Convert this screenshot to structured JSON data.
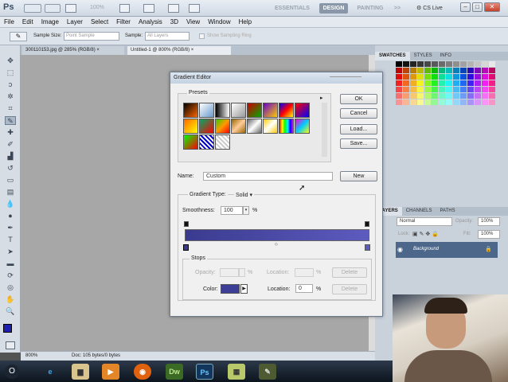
{
  "app": {
    "logo": "Ps",
    "zoom": "100%"
  },
  "workspace": {
    "essentials": "ESSENTIALS",
    "design": "DESIGN",
    "painting": "PAINTING",
    "more": ">>",
    "cs_live": "CS Live"
  },
  "menu": [
    "File",
    "Edit",
    "Image",
    "Layer",
    "Select",
    "Filter",
    "Analysis",
    "3D",
    "View",
    "Window",
    "Help"
  ],
  "options": {
    "sample_size_label": "Sample Size:",
    "sample_size_value": "Point Sample",
    "sample_label": "Sample:",
    "sample_value": "All Layers",
    "show_ring": "Show Sampling Ring"
  },
  "tabs": [
    {
      "label": "300110153.jpg @ 285% (RGB/8) ×"
    },
    {
      "label": "Untitled-1 @ 800% (RGB/8) ×"
    }
  ],
  "status": {
    "zoom": "800%",
    "doc": "Doc: 105 bytes/0 bytes"
  },
  "panels": {
    "tabs_top": [
      "SWATCHES",
      "STYLES",
      "INFO"
    ],
    "tabs_layers": [
      "LAYERS",
      "CHANNELS",
      "PATHS"
    ],
    "blend": "Normal",
    "opacity_label": "Opacity:",
    "opacity": "100%",
    "lock_label": "Lock:",
    "fill_label": "Fill:",
    "fill": "100%",
    "layer_name": "Background"
  },
  "dialog": {
    "title": "Gradient Editor",
    "presets_label": "Presets",
    "buttons": {
      "ok": "OK",
      "cancel": "Cancel",
      "load": "Load...",
      "save": "Save...",
      "new": "New"
    },
    "name_label": "Name:",
    "name_value": "Custom",
    "gradient_type_label": "Gradient Type:",
    "gradient_type_value": "Solid",
    "smoothness_label": "Smoothness:",
    "smoothness_value": "100",
    "percent": "%",
    "stops_label": "Stops",
    "opacity_label": "Opacity:",
    "location_label": "Location:",
    "delete_label": "Delete",
    "color_label": "Color:",
    "color_location_value": "0",
    "gradient_colors": [
      "#3a3b8f",
      "#5d5bbf"
    ],
    "stop_color": "#3d3f96"
  },
  "taskbar": {
    "start": "O",
    "apps": [
      "IE",
      "Explorer",
      "Media",
      "Firefox",
      "Dw",
      "Ps",
      "App",
      "Paint"
    ]
  }
}
